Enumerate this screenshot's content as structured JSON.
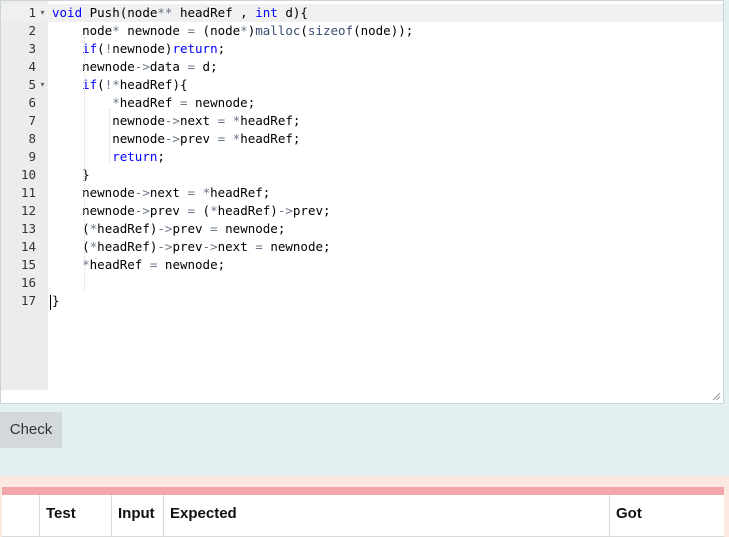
{
  "editor": {
    "lines": [
      {
        "n": "1",
        "fold": "▾",
        "html": "<span class=\"kw\">void</span> Push(node<span class=\"op\">**</span> headRef , <span class=\"kw\">int</span> d){"
      },
      {
        "n": "2",
        "fold": "",
        "html": "    node<span class=\"op\">*</span> newnode <span class=\"op\">=</span> (node<span class=\"op\">*</span>)<span class=\"fn\">malloc</span>(<span class=\"fn\">sizeof</span>(node));"
      },
      {
        "n": "3",
        "fold": "",
        "html": "    <span class=\"kw\">if</span>(<span class=\"op\">!</span>newnode)<span class=\"kw\">return</span>;"
      },
      {
        "n": "4",
        "fold": "",
        "html": "    newnode<span class=\"op\">-></span>data <span class=\"op\">=</span> d;"
      },
      {
        "n": "5",
        "fold": "▾",
        "html": "    <span class=\"kw\">if</span>(<span class=\"op\">!*</span>headRef){"
      },
      {
        "n": "6",
        "fold": "",
        "html": "        <span class=\"op\">*</span>headRef <span class=\"op\">=</span> newnode;"
      },
      {
        "n": "7",
        "fold": "",
        "html": "        newnode<span class=\"op\">-></span>next <span class=\"op\">=</span> <span class=\"op\">*</span>headRef;"
      },
      {
        "n": "8",
        "fold": "",
        "html": "        newnode<span class=\"op\">-></span>prev <span class=\"op\">=</span> <span class=\"op\">*</span>headRef;"
      },
      {
        "n": "9",
        "fold": "",
        "html": "        <span class=\"kw\">return</span>;"
      },
      {
        "n": "10",
        "fold": "",
        "html": "    }"
      },
      {
        "n": "11",
        "fold": "",
        "html": "    newnode<span class=\"op\">-></span>next <span class=\"op\">=</span> <span class=\"op\">*</span>headRef;"
      },
      {
        "n": "12",
        "fold": "",
        "html": "    newnode<span class=\"op\">-></span>prev <span class=\"op\">=</span> (<span class=\"op\">*</span>headRef)<span class=\"op\">-></span>prev;"
      },
      {
        "n": "13",
        "fold": "",
        "html": "    (<span class=\"op\">*</span>headRef)<span class=\"op\">-></span>prev <span class=\"op\">=</span> newnode;"
      },
      {
        "n": "14",
        "fold": "",
        "html": "    (<span class=\"op\">*</span>headRef)<span class=\"op\">-></span>prev<span class=\"op\">-></span>next <span class=\"op\">=</span> newnode;"
      },
      {
        "n": "15",
        "fold": "",
        "html": "    <span class=\"op\">*</span>headRef <span class=\"op\">=</span> newnode;"
      },
      {
        "n": "16",
        "fold": "",
        "html": ""
      },
      {
        "n": "17",
        "fold": "",
        "html": "}"
      }
    ]
  },
  "check_button": {
    "label": "Check"
  },
  "results": {
    "headers": [
      {
        "key": "blank",
        "label": ""
      },
      {
        "key": "test",
        "label": "Test"
      },
      {
        "key": "input",
        "label": "Input"
      },
      {
        "key": "expected",
        "label": "Expected"
      },
      {
        "key": "got",
        "label": "Got"
      }
    ]
  },
  "colors": {
    "keyword": "#0000ff",
    "operator": "#687687",
    "results_header_bar": "#f0a6ab",
    "results_background": "#fbe8de"
  }
}
